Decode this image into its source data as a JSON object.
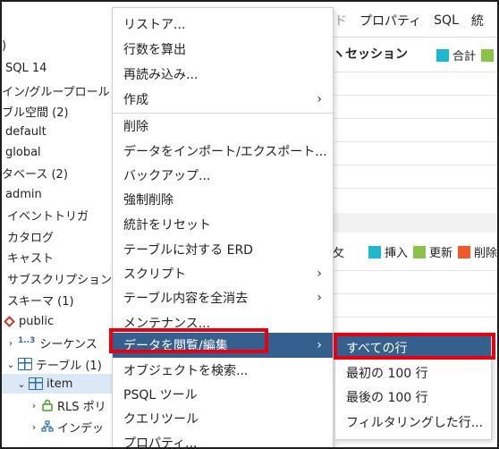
{
  "tree": {
    "items": [
      {
        "label": ")"
      },
      {
        "label": "SQL 14"
      },
      {
        "label": "イン/グループロール"
      },
      {
        "label": "ブル空間 (2)"
      },
      {
        "label": "default"
      },
      {
        "label": "global"
      },
      {
        "label": "タベース (2)"
      },
      {
        "label": "admin"
      },
      {
        "label": "イベントトリガ"
      },
      {
        "label": "カタログ"
      },
      {
        "label": "キャスト"
      },
      {
        "label": "サブスクリプション"
      },
      {
        "label": "スキーマ (1)"
      },
      {
        "label": "public"
      },
      {
        "label": "シーケンス",
        "icon_text": "1..3"
      },
      {
        "label": "テーブル (1)"
      },
      {
        "label": "item"
      },
      {
        "label": "RLS ポリ"
      },
      {
        "label": "インデッ"
      }
    ]
  },
  "panel": {
    "tabs": [
      "ド",
      "プロパティ",
      "SQL",
      "統"
    ],
    "sessions_title": "ヽセッション",
    "legend_top": {
      "total_label": "合計",
      "total_color": "#1fb7cf",
      "next_color": "#8bc34a"
    },
    "stub_label": "攵",
    "legend_bottom": {
      "insert_label": "挿入",
      "insert_color": "#1fb7cf",
      "update_label": "更新",
      "update_color": "#8bc34a",
      "delete_label": "削除",
      "delete_color": "#f05a28"
    }
  },
  "menu": {
    "items": [
      {
        "label": "リストア...",
        "arrow": false
      },
      {
        "label": "行数を算出",
        "arrow": false
      },
      {
        "label": "再読み込み...",
        "arrow": false
      },
      {
        "label": "作成",
        "arrow": true
      },
      {
        "label": "削除",
        "arrow": false
      },
      {
        "label": "データをインポート/エクスポート...",
        "arrow": false
      },
      {
        "label": "バックアップ...",
        "arrow": false
      },
      {
        "label": "強制削除",
        "arrow": false
      },
      {
        "label": "統計をリセット",
        "arrow": false
      },
      {
        "label": "テーブルに対する ERD",
        "arrow": false
      },
      {
        "label": "スクリプト",
        "arrow": true
      },
      {
        "label": "テーブル内容を全消去",
        "arrow": true
      },
      {
        "label": "メンテナンス...",
        "arrow": false
      },
      {
        "label": "データを閲覧/編集",
        "arrow": true,
        "active": true
      },
      {
        "label": "オブジェクトを検索...",
        "arrow": false
      },
      {
        "label": "PSQL ツール",
        "arrow": false
      },
      {
        "label": "クエリツール",
        "arrow": false
      },
      {
        "label": "プロパティ...",
        "arrow": false
      }
    ],
    "arrow_glyph": "›"
  },
  "submenu": {
    "items": [
      {
        "label": "すべての行",
        "active": true
      },
      {
        "label": "最初の 100 行"
      },
      {
        "label": "最後の 100 行"
      },
      {
        "label": "フィルタリングした行..."
      }
    ]
  },
  "highlight_color": "#e60012"
}
